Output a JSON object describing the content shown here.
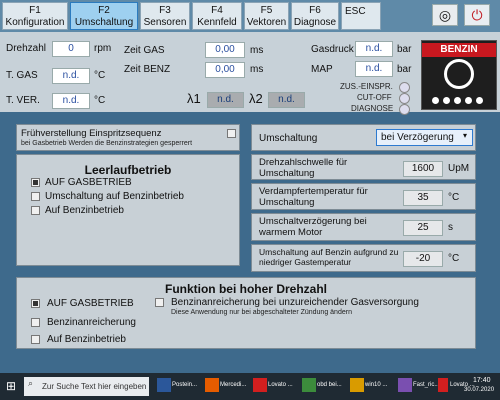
{
  "toolbar": {
    "tabs": [
      {
        "key": "F1",
        "label": "Konfiguration"
      },
      {
        "key": "F2",
        "label": "Umschaltung"
      },
      {
        "key": "F3",
        "label": "Sensoren"
      },
      {
        "key": "F4",
        "label": "Kennfeld"
      },
      {
        "key": "F5",
        "label": "Vektoren"
      },
      {
        "key": "F6",
        "label": "Diagnose"
      }
    ],
    "esc_label": "ESC",
    "colors": {
      "active_tab": "#9ed0f0",
      "toolbar": "#5f8aa8"
    }
  },
  "status": {
    "drehzahl_label": "Drehzahl",
    "drehzahl_value": "0",
    "drehzahl_unit": "rpm",
    "tgas_label": "T. GAS",
    "tgas_value": "n.d.",
    "tgas_unit": "°C",
    "tver_label": "T. VER.",
    "tver_value": "n.d.",
    "tver_unit": "°C",
    "zeitgas_label": "Zeit GAS",
    "zeitgas_value": "0,00",
    "zeitgas_unit": "ms",
    "zeitbenz_label": "Zeit BENZ",
    "zeitbenz_value": "0,00",
    "zeitbenz_unit": "ms",
    "lambda1_label": "λ1",
    "lambda1_value": "n.d.",
    "lambda2_label": "λ2",
    "lambda2_value": "n.d.",
    "gasdruck_label": "Gasdruck",
    "gasdruck_value": "n.d.",
    "gasdruck_unit": "bar",
    "map_label": "MAP",
    "map_value": "n.d.",
    "map_unit": "bar",
    "zus_label": "ZUS.-EINSPR.",
    "cutoff_label": "CUT-OFF",
    "diagnose_label": "DIAGNOSE",
    "benzin_label": "BENZIN"
  },
  "fruh": {
    "label": "Frühverstellung Einspritzsequenz",
    "sub": "bei Gasbetrieb Werden die Benzinstrategien gesperrert"
  },
  "leerlauf": {
    "title": "Leerlaufbetrieb",
    "options": [
      "AUF GASBETRIEB",
      "Umschaltung auf Benzinbetrieb",
      "Auf Benzinbetrieb"
    ],
    "checked_index": 0
  },
  "umschaltung": {
    "label": "Umschaltung",
    "selected": "bei Verzögerung",
    "rows": [
      {
        "label": "Drehzahlschwelle für Umschaltung",
        "value": "1600",
        "unit": "UpM"
      },
      {
        "label": "Verdampfertemperatur für Umschaltung",
        "value": "35",
        "unit": "°C"
      },
      {
        "label": "Umschaltverzögerung bei warmem Motor",
        "value": "25",
        "unit": "s"
      },
      {
        "label": "Umschaltung auf Benzin aufgrund zu niedriger Gastemperatur",
        "value": "-20",
        "unit": "°C"
      }
    ]
  },
  "hoch": {
    "title": "Funktion bei hoher Drehzahl",
    "options": [
      "AUF GASBETRIEB",
      "Benzinanreicherung",
      "Auf Benzinbetrieb"
    ],
    "checked_index": 0,
    "anreicherung_label": "Benzinanreicherung bei unzureichender Gasversorgung",
    "anreicherung_sub": "Diese Anwendung nur bei abgeschalteter Zündung ändern"
  },
  "taskbar": {
    "search_placeholder": "Zur Suche Text hier eingeben",
    "apps": [
      "Postein...",
      "Mercedi...",
      "Lovato ...",
      "obd bei...",
      "win10 ...",
      "Fast_ric...",
      "Lovato ..."
    ],
    "time": "17:40",
    "date": "30.07.2020"
  }
}
